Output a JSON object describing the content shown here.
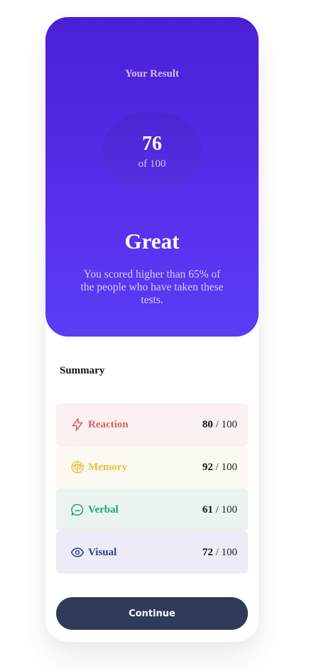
{
  "result": {
    "title": "Your Result",
    "score": "76",
    "score_of": "of 100",
    "grade": "Great",
    "description": "You scored higher than 65% of the people who have taken these tests."
  },
  "summary": {
    "title": "Summary",
    "items": [
      {
        "label": "Reaction",
        "score": "80",
        "max": " / 100",
        "icon": "lightning-icon",
        "color": "#d9625f",
        "bg": "#fbf1f0"
      },
      {
        "label": "Memory",
        "score": "92",
        "max": " / 100",
        "icon": "brain-icon",
        "color": "#eebe3a",
        "bg": "#fcf9f2"
      },
      {
        "label": "Verbal",
        "score": "61",
        "max": " / 100",
        "icon": "chat-icon",
        "color": "#21a678",
        "bg": "#eaf3f0"
      },
      {
        "label": "Visual",
        "score": "72",
        "max": " / 100",
        "icon": "eye-icon",
        "color": "#2b3d99",
        "bg": "#ececf6"
      }
    ]
  },
  "actions": {
    "continue_label": "Continue"
  },
  "colors": {
    "accent_top": "#4a20d6",
    "accent_bottom": "#5b3cf5",
    "button": "#303b5a"
  }
}
